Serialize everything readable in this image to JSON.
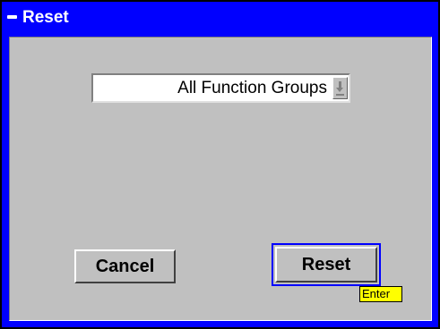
{
  "window": {
    "title": "Reset",
    "title_icon": "minimize-icon"
  },
  "dialog": {
    "function_group_select": {
      "selected_value": "All Function Groups",
      "arrow_icon": "down-arrow-icon"
    },
    "cancel_button": {
      "label": "Cancel"
    },
    "reset_button": {
      "label": "Reset",
      "focused": true
    },
    "reset_shortcut_hint": "Enter"
  },
  "colors": {
    "title_bar": "#0000ff",
    "panel": "#c0c0c0",
    "focus_ring": "#0000ff",
    "hint_badge": "#ffff00"
  }
}
